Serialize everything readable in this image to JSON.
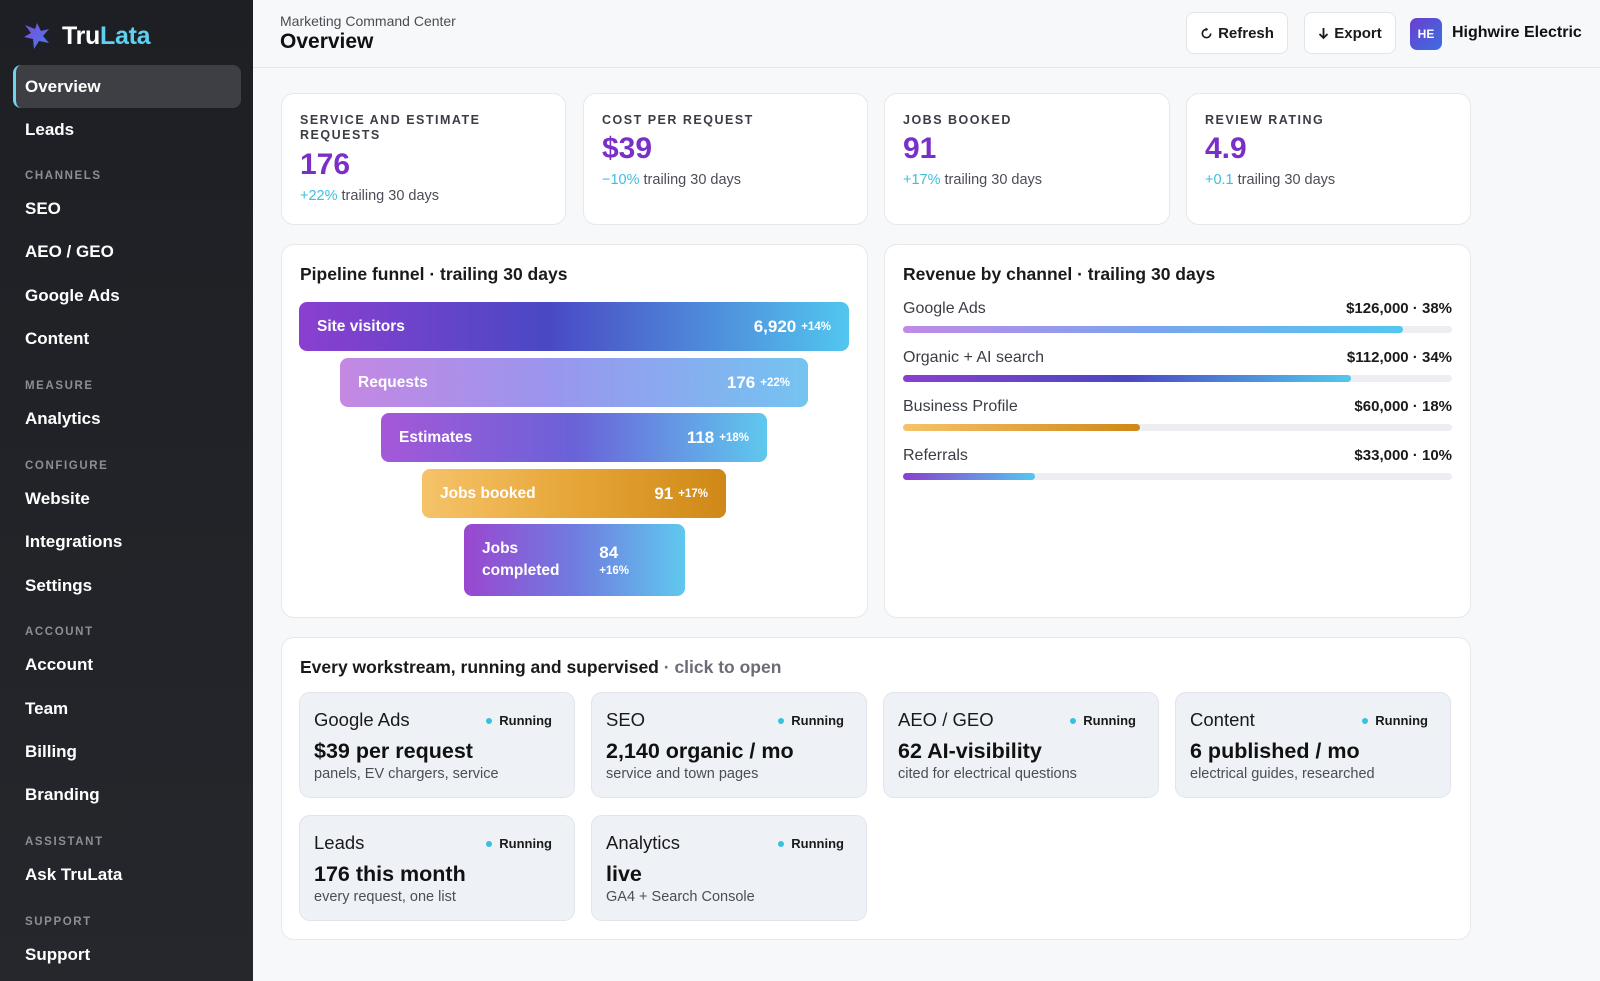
{
  "brand": {
    "part1": "Tru",
    "part2": "Lata"
  },
  "sidebar": {
    "nav": [
      {
        "label": "Overview",
        "active": true
      },
      {
        "label": "Leads"
      }
    ],
    "sections": [
      {
        "title": "CHANNELS",
        "items": [
          "SEO",
          "AEO / GEO",
          "Google Ads",
          "Content"
        ]
      },
      {
        "title": "MEASURE",
        "items": [
          "Analytics"
        ]
      },
      {
        "title": "CONFIGURE",
        "items": [
          "Website",
          "Integrations",
          "Settings"
        ]
      },
      {
        "title": "ACCOUNT",
        "items": [
          "Account",
          "Team",
          "Billing",
          "Branding"
        ]
      },
      {
        "title": "ASSISTANT",
        "items": [
          "Ask TruLata"
        ]
      },
      {
        "title": "SUPPORT",
        "items": [
          "Support"
        ]
      }
    ]
  },
  "header": {
    "breadcrumb": "Marketing Command Center",
    "title": "Overview",
    "refresh_label": "Refresh",
    "export_label": "Export",
    "avatar_initials": "HE",
    "org_name": "Highwire Electric"
  },
  "kpis": [
    {
      "label": "SERVICE AND ESTIMATE REQUESTS",
      "value": "176",
      "delta": "+22%",
      "period": "trailing 30 days"
    },
    {
      "label": "COST PER REQUEST",
      "value": "$39",
      "delta": "−10%",
      "period": "trailing 30 days"
    },
    {
      "label": "JOBS BOOKED",
      "value": "91",
      "delta": "+17%",
      "period": "trailing 30 days"
    },
    {
      "label": "REVIEW RATING",
      "value": "4.9",
      "delta": "+0.1",
      "period": "trailing 30 days"
    }
  ],
  "funnel": {
    "title": "Pipeline funnel · trailing 30 days",
    "stages": [
      {
        "label": "Site visitors",
        "value": "6,920",
        "delta": "+14%"
      },
      {
        "label": "Requests",
        "value": "176",
        "delta": "+22%"
      },
      {
        "label": "Estimates",
        "value": "118",
        "delta": "+18%"
      },
      {
        "label": "Jobs booked",
        "value": "91",
        "delta": "+17%"
      },
      {
        "label": "Jobs completed",
        "value": "84",
        "delta": "+16%"
      }
    ]
  },
  "revenue": {
    "title": "Revenue by channel · trailing 30 days",
    "channels": [
      {
        "name": "Google Ads",
        "value": "$126,000 · 38%",
        "share": 0.91
      },
      {
        "name": "Organic + AI search",
        "value": "$112,000 · 34%",
        "share": 0.816
      },
      {
        "name": "Business Profile",
        "value": "$60,000 · 18%",
        "share": 0.432
      },
      {
        "name": "Referrals",
        "value": "$33,000 · 10%",
        "share": 0.24
      }
    ]
  },
  "workstreams": {
    "title": "Every workstream, running and supervised",
    "subtitle": "· click to open",
    "tiles": [
      {
        "name": "Google Ads",
        "status": "Running",
        "metric": "$39 per request",
        "desc": "panels, EV chargers, service"
      },
      {
        "name": "SEO",
        "status": "Running",
        "metric": "2,140 organic / mo",
        "desc": "service and town pages"
      },
      {
        "name": "AEO / GEO",
        "status": "Running",
        "metric": "62 AI-visibility",
        "desc": "cited for electrical questions"
      },
      {
        "name": "Content",
        "status": "Running",
        "metric": "6 published / mo",
        "desc": "electrical guides, researched"
      },
      {
        "name": "Leads",
        "status": "Running",
        "metric": "176 this month",
        "desc": "every request, one list"
      },
      {
        "name": "Analytics",
        "status": "Running",
        "metric": "live",
        "desc": "GA4 + Search Console"
      }
    ]
  },
  "colors": {
    "accent_purple": "#7a2fc6",
    "accent_cyan": "#3bbfe0",
    "sidebar_bg": "#1d1f24"
  }
}
